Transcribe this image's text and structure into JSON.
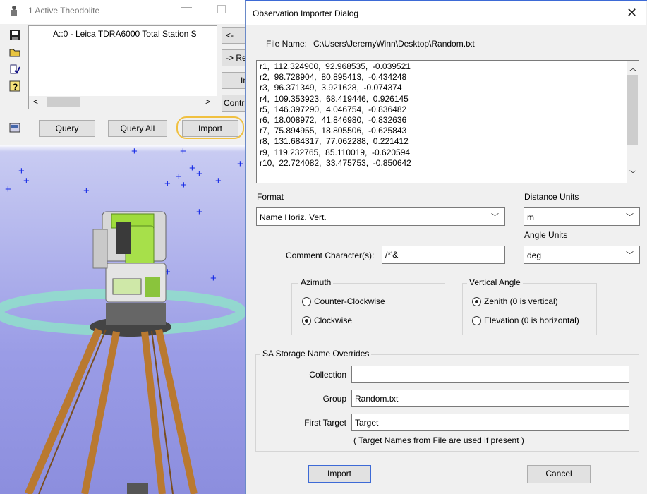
{
  "bg_window": {
    "title": "1 Active Theodolite",
    "device_entry": "A::0 - Leica TDRA6000 Total Station  S",
    "side_buttons": [
      "<-",
      "-> Re",
      "In",
      "Contr"
    ],
    "query_label": "Query",
    "query_all_label": "Query All",
    "import_label": "Import"
  },
  "dialog": {
    "title": "Observation Importer Dialog",
    "file_name_label": "File Name:",
    "file_name": "C:\\Users\\JeremyWinn\\Desktop\\Random.txt",
    "preview_lines": [
      "r1,  112.324900,  92.968535,  -0.039521",
      "r2,  98.728904,  80.895413,  -0.434248",
      "r3,  96.371349,  3.921628,  -0.074374",
      "r4,  109.353923,  68.419446,  0.926145",
      "r5,  146.397290,  4.046754,  -0.836482",
      "r6,  18.008972,  41.846980,  -0.832636",
      "r7,  75.894955,  18.805506,  -0.625843",
      "r8,  131.684317,  77.062288,  0.221412",
      "r9,  119.232765,  85.110019,  -0.620594",
      "r10,  22.724082,  33.475753,  -0.850642"
    ],
    "format_label": "Format",
    "format_value": "Name Horiz. Vert.",
    "distance_units_label": "Distance Units",
    "distance_units_value": "m",
    "angle_units_label": "Angle Units",
    "angle_units_value": "deg",
    "comment_label": "Comment Character(s):",
    "comment_value": "/*'&",
    "azimuth": {
      "label": "Azimuth",
      "options": [
        "Counter-Clockwise",
        "Clockwise"
      ],
      "selected": 1
    },
    "vertical_angle": {
      "label": "Vertical Angle",
      "options": [
        "Zenith (0 is vertical)",
        "Elevation (0 is horizontal)"
      ],
      "selected": 0
    },
    "overrides": {
      "label": "SA Storage Name Overrides",
      "collection_label": "Collection",
      "collection_value": "",
      "group_label": "Group",
      "group_value": "Random.txt",
      "first_target_label": "First Target",
      "first_target_value": "Target",
      "note": "( Target Names from File are used if present )"
    },
    "import_label": "Import",
    "cancel_label": "Cancel"
  },
  "colors": {
    "accent": "#3d6ad6",
    "highlight_ring": "#f0c040",
    "sky": "#9a9ce6",
    "star": "#1428e6"
  }
}
